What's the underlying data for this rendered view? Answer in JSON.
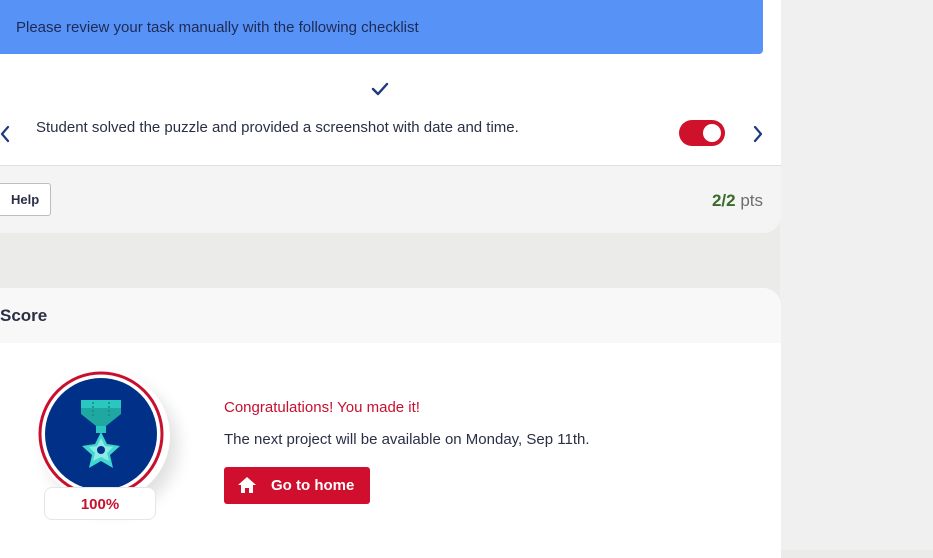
{
  "checklist": {
    "banner_text": "Please review your task manually with the following checklist",
    "criterion_text": "Student solved the puzzle and provided a screenshot with date and time.",
    "toggle_state": "on",
    "help_label": "Help",
    "points_value": "2/2",
    "points_unit": "pts"
  },
  "score": {
    "header": "Score",
    "percent": "100%",
    "congrats": "Congratulations! You made it!",
    "next_project": "The next project will be available on Monday, Sep 11th.",
    "home_button_label": "Go to home",
    "medal_icon": "star-medal-icon"
  },
  "colors": {
    "banner": "#5793f7",
    "accent_red": "#cf0f2d",
    "medal_navy": "#003087",
    "medal_teal": "#2ac6c0",
    "points_green": "#3a6a2a"
  }
}
